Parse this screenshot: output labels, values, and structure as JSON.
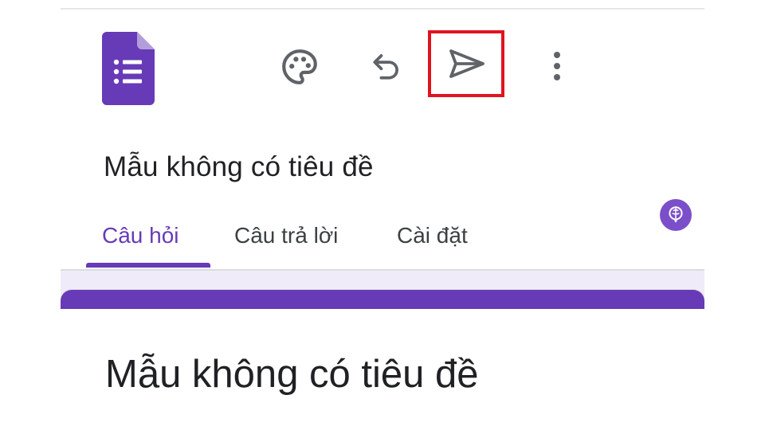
{
  "app": {
    "logo_icon": "google-forms-logo-icon",
    "brand_color": "#673ab7",
    "highlight_color": "#e0141e"
  },
  "toolbar": {
    "icons": [
      "palette-icon",
      "undo-icon",
      "send-icon",
      "more-vert-icon"
    ]
  },
  "header": {
    "title": "Mẫu không có tiêu đề"
  },
  "tabs": [
    {
      "label": "Câu hỏi",
      "active": true
    },
    {
      "label": "Câu trả lời",
      "active": false
    },
    {
      "label": "Cài đặt",
      "active": false
    }
  ],
  "form_card": {
    "title": "Mẫu không có tiêu đề"
  },
  "watermark": {
    "icon": "brain-logo-icon"
  }
}
